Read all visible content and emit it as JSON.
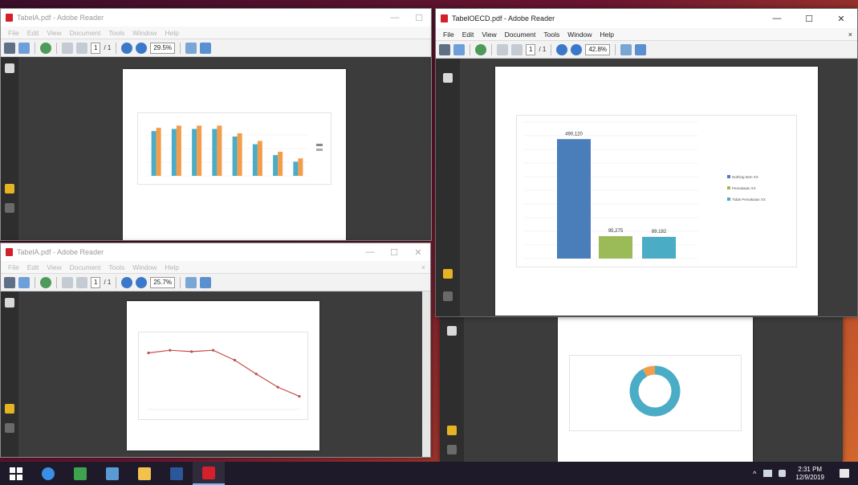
{
  "windows": {
    "top_left": {
      "title": "TabelA.pdf - Adobe Reader",
      "menu": [
        "File",
        "Edit",
        "View",
        "Document",
        "Tools",
        "Window",
        "Help"
      ],
      "page_field": "1",
      "page_total": "/ 1",
      "zoom": "29.5%"
    },
    "bottom_left": {
      "title": "TabelA.pdf - Adobe Reader",
      "menu": [
        "File",
        "Edit",
        "View",
        "Document",
        "Tools",
        "Window",
        "Help"
      ],
      "page_field": "1",
      "page_total": "/ 1",
      "zoom": "25.7%"
    },
    "right": {
      "title": "TabelOECD.pdf - Adobe Reader",
      "menu": [
        "File",
        "Edit",
        "View",
        "Document",
        "Tools",
        "Window",
        "Help"
      ],
      "page_field": "1",
      "page_total": "/ 1",
      "zoom": "42.8%"
    }
  },
  "window_controls": {
    "minimize": "—",
    "maximize": "☐",
    "close": "✕"
  },
  "menu_close": "×",
  "icons": {
    "print": "printer-icon",
    "export": "export-icon",
    "globe": "globe-icon",
    "prev_page": "up-arrow-icon",
    "next_page": "down-arrow-icon",
    "zoom_out": "zoom-out-icon",
    "zoom_in": "zoom-in-icon",
    "fit": "fit-page-icon"
  },
  "chart_data": [
    {
      "type": "bar",
      "source": "top-left window",
      "title": "",
      "categories": [
        "",
        "",
        "",
        "",
        "",
        "",
        "",
        ""
      ],
      "series": [
        {
          "color": "#4bacc6",
          "values": [
            82,
            86,
            86,
            86,
            72,
            58,
            38,
            26
          ]
        },
        {
          "color": "#f39c4a",
          "values": [
            88,
            92,
            92,
            92,
            78,
            64,
            44,
            32
          ]
        }
      ],
      "ylim": [
        0,
        100
      ],
      "legend": "right"
    },
    {
      "type": "line",
      "source": "bottom-left window",
      "title": "",
      "categories": [
        "",
        "",
        "",
        "",
        "",
        "",
        "",
        ""
      ],
      "values": [
        86,
        90,
        88,
        90,
        75,
        54,
        34,
        20
      ],
      "color": "#c0504d",
      "ylim": [
        0,
        100
      ],
      "legend": "none"
    },
    {
      "type": "bar",
      "source": "right window",
      "title": "",
      "categories": [
        "Nothing Item XX",
        "Pemakaian XX",
        "Tidak Pemakaian XX"
      ],
      "values": [
        490,
        92,
        89
      ],
      "data_labels": [
        "490,120",
        "95,275",
        "89,182"
      ],
      "colors": [
        "#4a7ebb",
        "#9bbb59",
        "#4bacc6"
      ],
      "legend_labels": [
        "Nothing Item XX",
        "Pemakaian XX",
        "Tidak Pemakaian XX"
      ],
      "ylim": [
        0,
        560
      ],
      "legend": "right"
    },
    {
      "type": "pie",
      "source": "bottom-right window",
      "title": "",
      "style": "donut",
      "slices": [
        {
          "value": 92,
          "color": "#4bacc6"
        },
        {
          "value": 8,
          "color": "#f39c4a"
        }
      ]
    }
  ],
  "taskbar": {
    "apps": [
      {
        "icon": "windows-start-icon",
        "color": "#ffffff"
      },
      {
        "icon": "edge-browser-icon",
        "color": "#3a8ee6"
      },
      {
        "icon": "app-green-icon",
        "color": "#3fa34d"
      },
      {
        "icon": "store-icon",
        "color": "#5b9bd5"
      },
      {
        "icon": "file-explorer-icon",
        "color": "#f2c14e"
      },
      {
        "icon": "word-icon",
        "color": "#2b579a"
      },
      {
        "icon": "adobe-reader-icon",
        "color": "#d3202a"
      }
    ],
    "tray_chevron": "^",
    "time": "2:31 PM",
    "date": "12/9/2019"
  }
}
